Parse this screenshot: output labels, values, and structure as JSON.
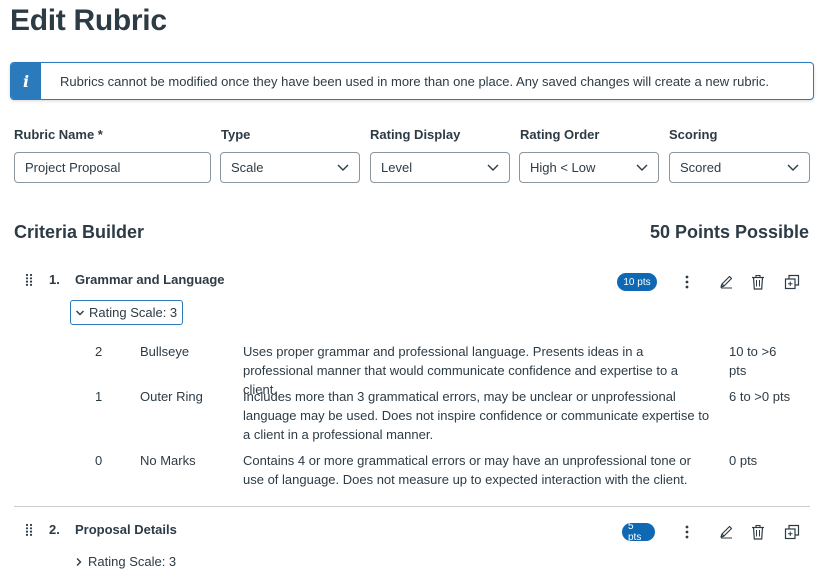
{
  "page": {
    "title": "Edit Rubric"
  },
  "alert": {
    "text": "Rubrics cannot be modified once they have been used in more than one place. Any saved changes will create a new rubric.",
    "icon": "info-icon",
    "color": "#2b7abc"
  },
  "form": {
    "rubric_name": {
      "label": "Rubric Name *",
      "value": "Project Proposal"
    },
    "type": {
      "label": "Type",
      "value": "Scale"
    },
    "rating_display": {
      "label": "Rating Display",
      "value": "Level"
    },
    "rating_order": {
      "label": "Rating Order",
      "value": "High < Low"
    },
    "scoring": {
      "label": "Scoring",
      "value": "Scored"
    }
  },
  "criteria_builder": {
    "title": "Criteria Builder",
    "points_possible": "50 Points Possible",
    "criteria": [
      {
        "number": "1.",
        "title": "Grammar and Language",
        "points_badge": "10 pts",
        "rating_scale_label": "Rating Scale: 3",
        "expanded": true,
        "ratings": [
          {
            "score": "2",
            "name": "Bullseye",
            "description": "Uses proper grammar and professional language. Presents ideas in a professional manner that would communicate confidence and expertise to a client.",
            "points": "10 to >6 pts"
          },
          {
            "score": "1",
            "name": "Outer Ring",
            "description": "Includes more than 3 grammatical errors, may be unclear or unprofessional language may be used. Does not inspire confidence or communicate expertise to a client in a professional manner.",
            "points": "6 to >0 pts"
          },
          {
            "score": "0",
            "name": "No Marks",
            "description": "Contains 4 or more grammatical errors or may have an unprofessional tone or use of language. Does not measure up to expected interaction with the client.",
            "points": "0 pts"
          }
        ]
      },
      {
        "number": "2.",
        "title": "Proposal Details",
        "points_badge": "5 pts",
        "rating_scale_label": "Rating Scale: 3",
        "expanded": false
      }
    ]
  },
  "colors": {
    "accent": "#2b7abc",
    "badge": "#0e68b3",
    "text": "#2d3b45"
  }
}
